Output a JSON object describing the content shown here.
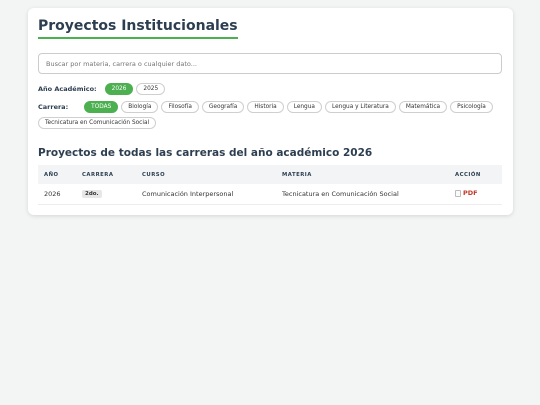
{
  "page": {
    "title": "Proyectos Institucionales"
  },
  "search": {
    "placeholder": "Buscar por materia, carrera o cualquier dato..."
  },
  "filters": {
    "year_label": "Año Académico:",
    "years": [
      "2026",
      "2025"
    ],
    "career_label": "Carrera:",
    "careers": [
      "TODAS",
      "Biología",
      "Filosofía",
      "Geografía",
      "Historia",
      "Lengua",
      "Lengua y Literatura",
      "Matemática",
      "Psicología",
      "Tecnicatura en Comunicación Social"
    ]
  },
  "results": {
    "subtitle": "Proyectos de todas las carreras del año académico 2026"
  },
  "table": {
    "headers": [
      "AÑO",
      "CARRERA",
      "CURSO",
      "MATERIA",
      "ACCIÓN"
    ],
    "rows": [
      {
        "year": "2026",
        "course": "2do.",
        "subject": "Comunicación Interpersonal",
        "career": "Tecnicatura en Comunicación Social",
        "action": "PDF"
      }
    ]
  },
  "colors": {
    "accent": "#4caf50",
    "pdf": "#c0392b"
  }
}
